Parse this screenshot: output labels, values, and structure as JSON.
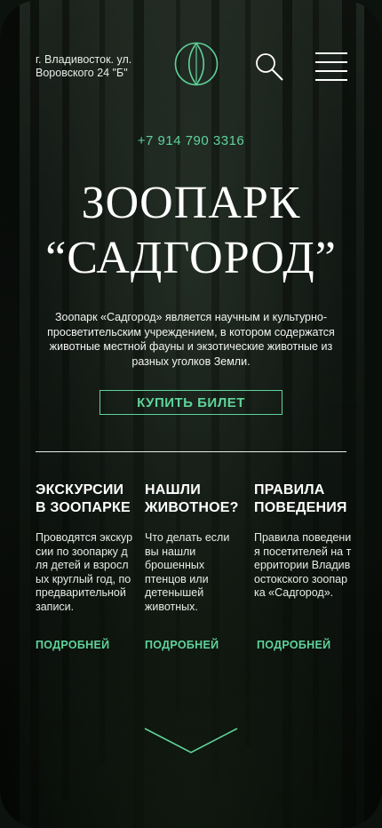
{
  "header": {
    "address": "г. Владивосток. ул. Воровского 24 \"Б\"",
    "logo_icon": "eye-logo-icon",
    "search_icon": "search-icon",
    "menu_icon": "hamburger-menu-icon"
  },
  "hero": {
    "phone": "+7 914 790 3316",
    "title_line1": "ЗООПАРК",
    "title_line2": "“САДГОРОД”",
    "description": "Зоопарк «Садгород» является научным и культурно-просветительским учреждением, в котором содержатся животные местной фауны и экзотические животные из разных уголков Земли.",
    "cta_label": "КУПИТЬ БИЛЕТ"
  },
  "cards": [
    {
      "title": "ЭКСКУРСИИ В ЗООПАРКЕ",
      "text": "Проводятся экскурсии по зоопарку для детей и взрослых круглый год, по предварительной записи.",
      "link": "ПОДРОБНЕЙ"
    },
    {
      "title": "НАШЛИ ЖИВОТНОЕ?",
      "text": "Что делать если вы нашли брошенных птенцов или детенышей животных.",
      "link": "ПОДРОБНЕЙ"
    },
    {
      "title": "ПРАВИЛА ПОВЕДЕНИЯ",
      "text": "Правила поведения посетителей на территории Владивостокского зоопарка «Садгород».",
      "link": "ПОДРОБНЕЙ"
    }
  ],
  "scroll_icon": "chevron-down-icon",
  "colors": {
    "accent": "#5fd39a",
    "text": "#ffffff"
  }
}
